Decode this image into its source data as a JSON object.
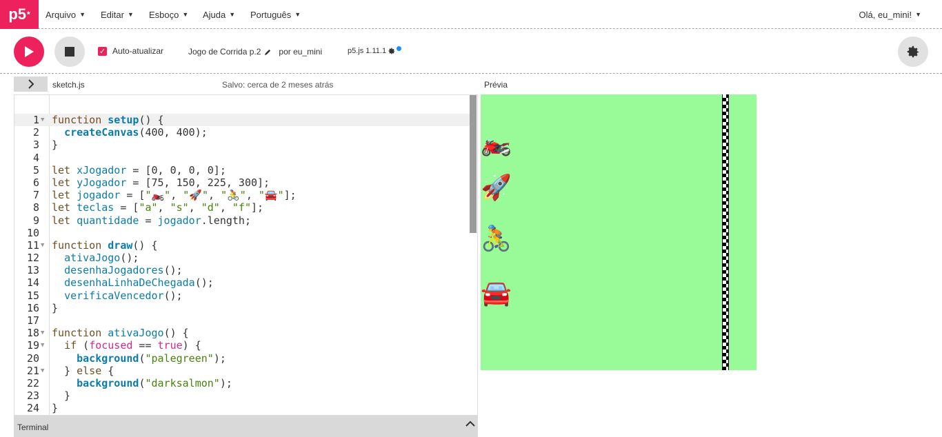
{
  "nav": {
    "logo": "p5",
    "logo_sup": "*",
    "menus": [
      "Arquivo",
      "Editar",
      "Esboço",
      "Ajuda",
      "Português"
    ],
    "user": "Olá, eu_mini!"
  },
  "toolbar": {
    "auto_refresh_label": "Auto-atualizar",
    "project_name": "Jogo de Corrida p.2",
    "by_label": "por eu_mini",
    "version": "p5.js 1.11.1"
  },
  "editor": {
    "filename": "sketch.js",
    "saved": "Salvo: cerca de 2 meses atrás",
    "terminal_label": "Terminal"
  },
  "preview": {
    "label": "Prévia",
    "background": "#98fb98",
    "players": [
      "🏍️",
      "🚀",
      "🚴",
      "🚘"
    ]
  },
  "code_lines": [
    "function setup() {",
    "  createCanvas(400, 400);",
    "}",
    "",
    "let xJogador = [0, 0, 0, 0];",
    "let yJogador = [75, 150, 225, 300];",
    "let jogador = [\"🏍️\", \"🚀\", \"🚴\", \"🚘\"];",
    "let teclas = [\"a\", \"s\", \"d\", \"f\"];",
    "let quantidade = jogador.length;",
    "",
    "function draw() {",
    "  ativaJogo();",
    "  desenhaJogadores();",
    "  desenhaLinhaDeChegada();",
    "  verificaVencedor();",
    "}",
    "",
    "function ativaJogo() {",
    "  if (focused == true) {",
    "    background(\"palegreen\");",
    "  } else {",
    "    background(\"darksalmon\");",
    "  }",
    "}"
  ],
  "colors": {
    "accent": "#ed225d"
  }
}
